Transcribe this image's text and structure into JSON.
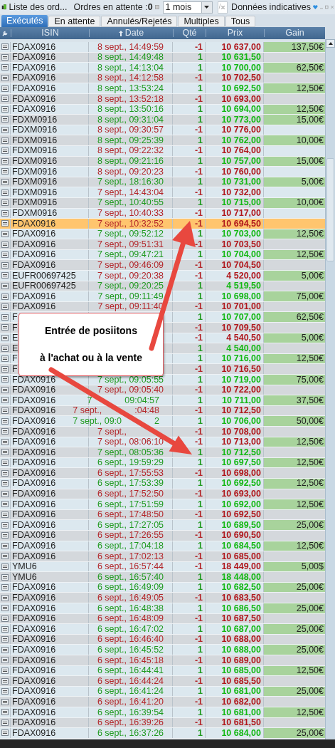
{
  "toolbar": {
    "title": "Liste des ord...",
    "pending": "Ordres en attente :**0**",
    "period": "1 mois",
    "filter": "/",
    "info": "Données indicatives"
  },
  "tabs": [
    {
      "label": "Exécutés",
      "selected": true
    },
    {
      "label": "En attente",
      "selected": false
    },
    {
      "label": "Annulés/Rejetés",
      "selected": false
    },
    {
      "label": "Multiples",
      "selected": false
    },
    {
      "label": "Tous",
      "selected": false
    }
  ],
  "columns": [
    {
      "label": "ISIN",
      "sorted": false
    },
    {
      "label": "Date",
      "sorted": true
    },
    {
      "label": "Qté",
      "sorted": false
    },
    {
      "label": "Prix",
      "sorted": false
    },
    {
      "label": "Gain",
      "sorted": false
    }
  ],
  "rows": [
    {
      "isin": "FDAX0916",
      "date": "8 sept., 14:49:59",
      "qty": "-1",
      "price": "10 637,00",
      "gain": "137,50€",
      "kind": "sell",
      "selected": false
    },
    {
      "isin": "FDAX0916",
      "date": "8 sept., 14:49:48",
      "qty": "1",
      "price": "10 631,50",
      "kind": "buy",
      "selected": false
    },
    {
      "isin": "FDAX0916",
      "date": "8 sept., 14:13:04",
      "qty": "1",
      "price": "10 700,00",
      "gain": "62,50€",
      "kind": "buy",
      "selected": false
    },
    {
      "isin": "FDAX0916",
      "date": "8 sept., 14:12:58",
      "qty": "-1",
      "price": "10 702,50",
      "kind": "sell",
      "selected": false
    },
    {
      "isin": "FDAX0916",
      "date": "8 sept., 13:53:24",
      "qty": "1",
      "price": "10 692,50",
      "gain": "12,50€",
      "kind": "buy",
      "selected": false
    },
    {
      "isin": "FDAX0916",
      "date": "8 sept., 13:52:18",
      "qty": "-1",
      "price": "10 693,00",
      "kind": "sell",
      "selected": false
    },
    {
      "isin": "FDAX0916",
      "date": "8 sept., 13:50:16",
      "qty": "1",
      "price": "10 694,00",
      "gain": "12,50€",
      "kind": "buy",
      "selected": false
    },
    {
      "isin": "FDXM0916",
      "date": "8 sept., 09:31:04",
      "qty": "1",
      "price": "10 773,00",
      "gain": "15,00€",
      "kind": "buy",
      "selected": false
    },
    {
      "isin": "FDXM0916",
      "date": "8 sept., 09:30:57",
      "qty": "-1",
      "price": "10 776,00",
      "kind": "sell",
      "selected": false
    },
    {
      "isin": "FDXM0916",
      "date": "8 sept., 09:25:39",
      "qty": "1",
      "price": "10 762,00",
      "gain": "10,00€",
      "kind": "buy",
      "selected": false
    },
    {
      "isin": "FDXM0916",
      "date": "8 sept., 09:22:32",
      "qty": "-1",
      "price": "10 764,00",
      "kind": "sell",
      "selected": false
    },
    {
      "isin": "FDXM0916",
      "date": "8 sept., 09:21:16",
      "qty": "1",
      "price": "10 757,00",
      "gain": "15,00€",
      "kind": "buy",
      "selected": false
    },
    {
      "isin": "FDXM0916",
      "date": "8 sept., 09:20:23",
      "qty": "-1",
      "price": "10 760,00",
      "kind": "sell",
      "selected": false
    },
    {
      "isin": "FDXM0916",
      "date": "7 sept., 18:16:30",
      "qty": "1",
      "price": "10 731,00",
      "gain": "5,00€",
      "kind": "buy",
      "selected": false
    },
    {
      "isin": "FDXM0916",
      "date": "7 sept., 14:43:04",
      "qty": "-1",
      "price": "10 732,00",
      "kind": "sell",
      "selected": false
    },
    {
      "isin": "FDXM0916",
      "date": "7 sept., 10:40:55",
      "qty": "1",
      "price": "10 715,00",
      "gain": "10,00€",
      "kind": "buy",
      "selected": false
    },
    {
      "isin": "FDXM0916",
      "date": "7 sept., 10:40:33",
      "qty": "-1",
      "price": "10 717,00",
      "kind": "sell",
      "selected": false
    },
    {
      "isin": "FDAX0916",
      "date": "7 sept., 10:32:52",
      "qty": "-1",
      "price": "10 694,50",
      "kind": "sell",
      "selected": true
    },
    {
      "isin": "FDAX0916",
      "date": "7 sept., 09:52:12",
      "qty": "1",
      "price": "10 703,00",
      "gain": "12,50€",
      "kind": "buy",
      "selected": false
    },
    {
      "isin": "FDAX0916",
      "date": "7 sept., 09:51:31",
      "qty": "-1",
      "price": "10 703,50",
      "kind": "sell",
      "selected": false
    },
    {
      "isin": "FDAX0916",
      "date": "7 sept., 09:47:21",
      "qty": "1",
      "price": "10 704,00",
      "gain": "12,50€",
      "kind": "buy",
      "selected": false
    },
    {
      "isin": "FDAX0916",
      "date": "7 sept., 09:46:09",
      "qty": "-1",
      "price": "10 704,50",
      "kind": "sell",
      "selected": false
    },
    {
      "isin": "EUFR00697425",
      "date": "7 sept., 09:20:38",
      "qty": "-1",
      "price": "4 520,00",
      "gain": "5,00€",
      "kind": "sell",
      "selected": false
    },
    {
      "isin": "EUFR00697425",
      "date": "7 sept., 09:20:25",
      "qty": "1",
      "price": "4 519,50",
      "kind": "buy",
      "selected": false
    },
    {
      "isin": "FDAX0916",
      "date": "7 sept., 09:11:49",
      "qty": "1",
      "price": "10 698,00",
      "gain": "75,00€",
      "kind": "buy",
      "selected": false
    },
    {
      "isin": "FDAX0916",
      "date": "7 sept., 09:11:40",
      "qty": "-1",
      "price": "10 701,00",
      "kind": "sell",
      "selected": false
    },
    {
      "isin": "F",
      "qty": "1",
      "price": "10 707,00",
      "gain": "62,50€",
      "kind": "buy",
      "selected": false
    },
    {
      "isin": "F",
      "qty": "-1",
      "price": "10 709,50",
      "kind": "sell",
      "selected": false
    },
    {
      "isin": "E",
      "qty": "-1",
      "price": "4 540,50",
      "gain": "5,00€",
      "kind": "sell",
      "selected": false
    },
    {
      "isin": "E",
      "qty": "1",
      "price": "4 540,00",
      "kind": "buy",
      "selected": false
    },
    {
      "isin": "F",
      "qty": "1",
      "price": "10 716,00",
      "gain": "12,50€",
      "kind": "buy",
      "selected": false
    },
    {
      "isin": "F",
      "qty": "-1",
      "price": "10 716,50",
      "kind": "sell",
      "selected": false
    },
    {
      "isin": "FDAX0916",
      "date": "7 sept., 09:05:55",
      "qty": "1",
      "price": "10 719,00",
      "gain": "75,00€",
      "kind": "buy",
      "selected": false
    },
    {
      "isin": "FDAX0916",
      "date": "7 sept., 09:05:40",
      "qty": "-1",
      "price": "10 722,00",
      "kind": "sell",
      "selected": false
    },
    {
      "isin": "FDAX0916",
      "date_parts": [
        "7",
        "09:04:57"
      ],
      "qty": "1",
      "price": "10 711,00",
      "gain": "37,50€",
      "kind": "buy",
      "selected": false
    },
    {
      "isin": "FDAX0916",
      "date_parts": [
        "7 sept.,",
        ":04:48"
      ],
      "qty": "-1",
      "price": "10 712,50",
      "kind": "sell",
      "selected": false
    },
    {
      "isin": "FDAX0916",
      "date_parts": [
        "7 sept., 09:0",
        "2"
      ],
      "qty": "1",
      "price": "10 706,00",
      "gain": "50,00€",
      "kind": "buy",
      "selected": false
    },
    {
      "isin": "FDAX0916",
      "date_parts": [
        "7 sept.,"
      ],
      "qty": "-1",
      "price": "10 708,00",
      "kind": "sell",
      "selected": false
    },
    {
      "isin": "FDAX0916",
      "date": "7 sept., 08:06:10",
      "qty": "-1",
      "price": "10 713,00",
      "gain": "12,50€",
      "kind": "sell",
      "selected": false
    },
    {
      "isin": "FDAX0916",
      "date": "7 sept., 08:05:36",
      "qty": "1",
      "price": "10 712,50",
      "kind": "buy",
      "selected": false
    },
    {
      "isin": "FDAX0916",
      "date": "6 sept., 19:59:29",
      "qty": "1",
      "price": "10 697,50",
      "gain": "12,50€",
      "kind": "buy",
      "selected": false
    },
    {
      "isin": "FDAX0916",
      "date": "6 sept., 17:55:53",
      "qty": "-1",
      "price": "10 698,00",
      "kind": "sell",
      "selected": false
    },
    {
      "isin": "FDAX0916",
      "date": "6 sept., 17:53:39",
      "qty": "1",
      "price": "10 692,50",
      "gain": "12,50€",
      "kind": "buy",
      "selected": false
    },
    {
      "isin": "FDAX0916",
      "date": "6 sept., 17:52:50",
      "qty": "-1",
      "price": "10 693,00",
      "kind": "sell",
      "selected": false
    },
    {
      "isin": "FDAX0916",
      "date": "6 sept., 17:51:59",
      "qty": "1",
      "price": "10 692,00",
      "gain": "12,50€",
      "kind": "buy",
      "selected": false
    },
    {
      "isin": "FDAX0916",
      "date": "6 sept., 17:48:50",
      "qty": "-1",
      "price": "10 692,50",
      "kind": "sell",
      "selected": false
    },
    {
      "isin": "FDAX0916",
      "date": "6 sept., 17:27:05",
      "qty": "1",
      "price": "10 689,50",
      "gain": "25,00€",
      "kind": "buy",
      "selected": false
    },
    {
      "isin": "FDAX0916",
      "date": "6 sept., 17:26:55",
      "qty": "-1",
      "price": "10 690,50",
      "kind": "sell",
      "selected": false
    },
    {
      "isin": "FDAX0916",
      "date": "6 sept., 17:04:18",
      "qty": "1",
      "price": "10 684,50",
      "gain": "12,50€",
      "kind": "buy",
      "selected": false
    },
    {
      "isin": "FDAX0916",
      "date": "6 sept., 17:02:13",
      "qty": "-1",
      "price": "10 685,00",
      "kind": "sell",
      "selected": false
    },
    {
      "isin": "YMU6",
      "date": "6 sept., 16:57:44",
      "qty": "-1",
      "price": "18 449,00",
      "gain": "5,00$",
      "kind": "sell",
      "selected": false
    },
    {
      "isin": "YMU6",
      "date": "6 sept., 16:57:40",
      "qty": "1",
      "price": "18 448,00",
      "kind": "buy",
      "selected": false
    },
    {
      "isin": "FDAX0916",
      "date": "6 sept., 16:49:09",
      "qty": "1",
      "price": "10 682,50",
      "gain": "25,00€",
      "kind": "buy",
      "selected": false
    },
    {
      "isin": "FDAX0916",
      "date": "6 sept., 16:49:05",
      "qty": "-1",
      "price": "10 683,50",
      "kind": "sell",
      "selected": false
    },
    {
      "isin": "FDAX0916",
      "date": "6 sept., 16:48:38",
      "qty": "1",
      "price": "10 686,50",
      "gain": "25,00€",
      "kind": "buy",
      "selected": false
    },
    {
      "isin": "FDAX0916",
      "date": "6 sept., 16:48:09",
      "qty": "-1",
      "price": "10 687,50",
      "kind": "sell",
      "selected": false
    },
    {
      "isin": "FDAX0916",
      "date": "6 sept., 16:47:02",
      "qty": "1",
      "price": "10 687,00",
      "gain": "25,00€",
      "kind": "buy",
      "selected": false
    },
    {
      "isin": "FDAX0916",
      "date": "6 sept., 16:46:40",
      "qty": "-1",
      "price": "10 688,00",
      "kind": "sell",
      "selected": false
    },
    {
      "isin": "FDAX0916",
      "date": "6 sept., 16:45:52",
      "qty": "1",
      "price": "10 688,00",
      "gain": "25,00€",
      "kind": "buy",
      "selected": false
    },
    {
      "isin": "FDAX0916",
      "date": "6 sept., 16:45:18",
      "qty": "-1",
      "price": "10 689,00",
      "kind": "sell",
      "selected": false
    },
    {
      "isin": "FDAX0916",
      "date": "6 sept., 16:44:41",
      "qty": "1",
      "price": "10 685,00",
      "gain": "12,50€",
      "kind": "buy",
      "selected": false
    },
    {
      "isin": "FDAX0916",
      "date": "6 sept., 16:44:24",
      "qty": "-1",
      "price": "10 685,50",
      "kind": "sell",
      "selected": false
    },
    {
      "isin": "FDAX0916",
      "date": "6 sept., 16:41:24",
      "qty": "1",
      "price": "10 681,00",
      "gain": "25,00€",
      "kind": "buy",
      "selected": false
    },
    {
      "isin": "FDAX0916",
      "date": "6 sept., 16:41:20",
      "qty": "-1",
      "price": "10 682,00",
      "kind": "sell",
      "selected": false
    },
    {
      "isin": "FDAX0916",
      "date": "6 sept., 16:39:54",
      "qty": "1",
      "price": "10 681,00",
      "gain": "12,50€",
      "kind": "buy",
      "selected": false
    },
    {
      "isin": "FDAX0916",
      "date": "6 sept., 16:39:26",
      "qty": "-1",
      "price": "10 681,50",
      "kind": "sell",
      "selected": false
    },
    {
      "isin": "FDAX0916",
      "date": "6 sept., 16:37:26",
      "qty": "1",
      "price": "10 684,00",
      "gain": "25,00€",
      "kind": "buy",
      "selected": false
    }
  ],
  "callout": {
    "lines": [
      "Entrée de posiitons",
      "à l'achat ou à la vente"
    ]
  }
}
